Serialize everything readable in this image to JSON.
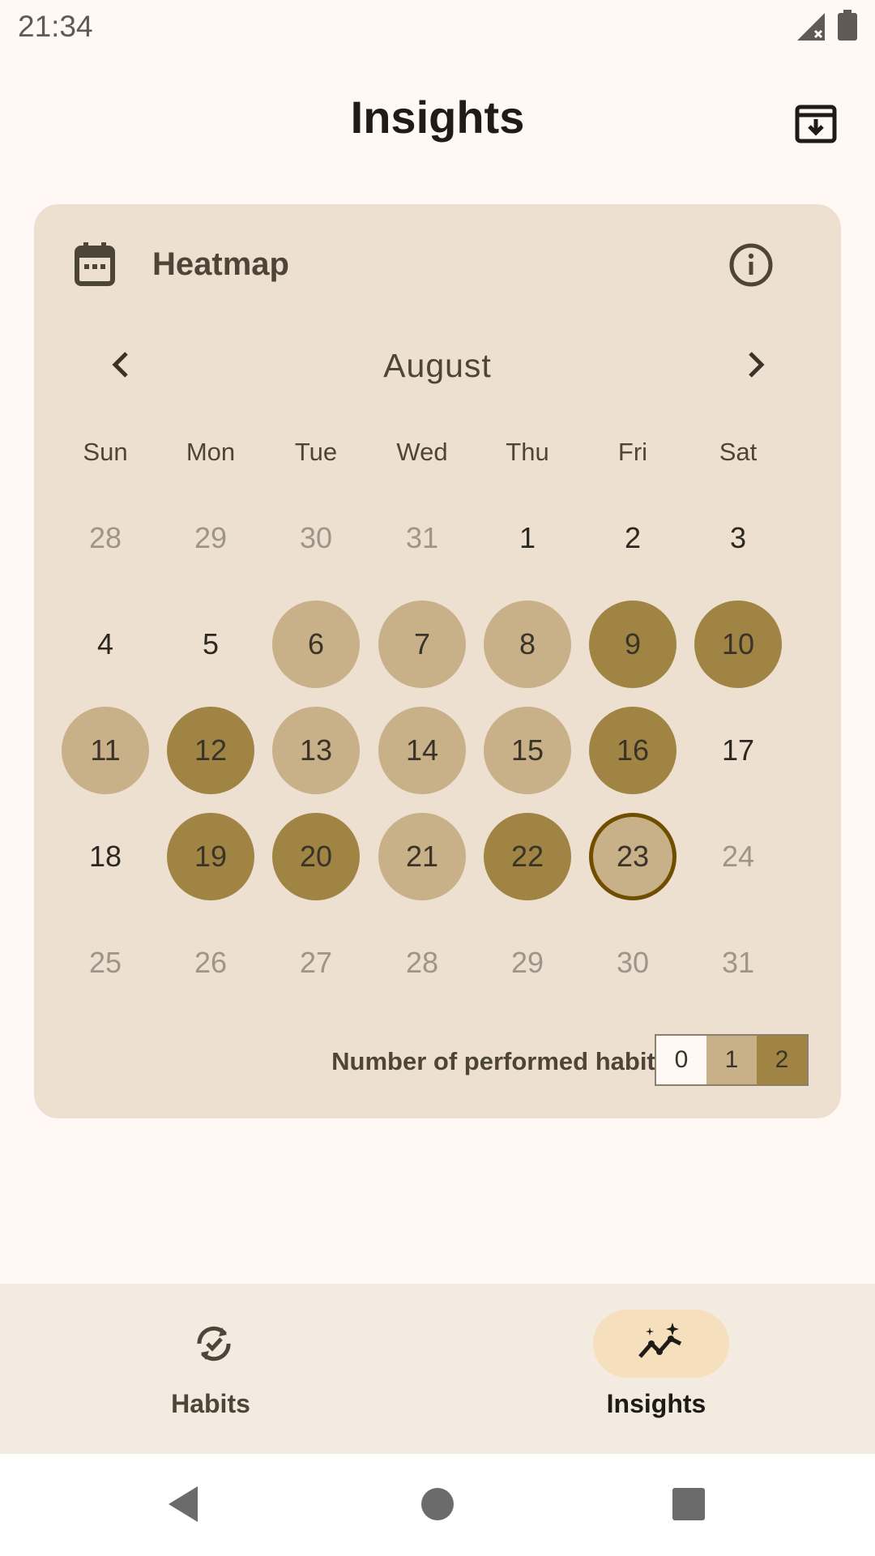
{
  "status_bar": {
    "time": "21:34",
    "icons": [
      "signal-off-icon",
      "battery-icon"
    ]
  },
  "app_bar": {
    "title": "Insights",
    "action_icon": "archive-download-icon"
  },
  "heatmap_card": {
    "title": "Heatmap",
    "header_icon": "calendar-icon",
    "info_icon": "info-icon",
    "month": "August",
    "prev_icon": "chevron-left-icon",
    "next_icon": "chevron-right-icon",
    "weekdays": [
      "Sun",
      "Mon",
      "Tue",
      "Wed",
      "Thu",
      "Fri",
      "Sat"
    ],
    "weeks": [
      [
        {
          "d": "28",
          "outside": true,
          "level": 0
        },
        {
          "d": "29",
          "outside": true,
          "level": 0
        },
        {
          "d": "30",
          "outside": true,
          "level": 0
        },
        {
          "d": "31",
          "outside": true,
          "level": 0
        },
        {
          "d": "1",
          "outside": false,
          "level": 0
        },
        {
          "d": "2",
          "outside": false,
          "level": 0
        },
        {
          "d": "3",
          "outside": false,
          "level": 0
        }
      ],
      [
        {
          "d": "4",
          "outside": false,
          "level": 0
        },
        {
          "d": "5",
          "outside": false,
          "level": 0
        },
        {
          "d": "6",
          "outside": false,
          "level": 1
        },
        {
          "d": "7",
          "outside": false,
          "level": 1
        },
        {
          "d": "8",
          "outside": false,
          "level": 1
        },
        {
          "d": "9",
          "outside": false,
          "level": 2
        },
        {
          "d": "10",
          "outside": false,
          "level": 2
        }
      ],
      [
        {
          "d": "11",
          "outside": false,
          "level": 1
        },
        {
          "d": "12",
          "outside": false,
          "level": 2
        },
        {
          "d": "13",
          "outside": false,
          "level": 1
        },
        {
          "d": "14",
          "outside": false,
          "level": 1
        },
        {
          "d": "15",
          "outside": false,
          "level": 1
        },
        {
          "d": "16",
          "outside": false,
          "level": 2
        },
        {
          "d": "17",
          "outside": false,
          "level": 0
        }
      ],
      [
        {
          "d": "18",
          "outside": false,
          "level": 0
        },
        {
          "d": "19",
          "outside": false,
          "level": 2
        },
        {
          "d": "20",
          "outside": false,
          "level": 2
        },
        {
          "d": "21",
          "outside": false,
          "level": 1
        },
        {
          "d": "22",
          "outside": false,
          "level": 2
        },
        {
          "d": "23",
          "outside": false,
          "level": 1,
          "today": true
        },
        {
          "d": "24",
          "outside": true,
          "level": 0
        }
      ],
      [
        {
          "d": "25",
          "outside": true,
          "level": 0
        },
        {
          "d": "26",
          "outside": true,
          "level": 0
        },
        {
          "d": "27",
          "outside": true,
          "level": 0
        },
        {
          "d": "28",
          "outside": true,
          "level": 0
        },
        {
          "d": "29",
          "outside": true,
          "level": 0
        },
        {
          "d": "30",
          "outside": true,
          "level": 0
        },
        {
          "d": "31",
          "outside": true,
          "level": 0
        }
      ]
    ],
    "legend_label": "Number of performed habits",
    "legend_values": [
      "0",
      "1",
      "2"
    ],
    "colors": {
      "level0": "#fff8f4",
      "level1": "#c8b088",
      "level2": "#a08444",
      "today_ring": "#6f4e00",
      "card_bg": "#ede0d0"
    }
  },
  "bottom_nav": {
    "items": [
      {
        "label": "Habits",
        "icon": "habits-check-cycle-icon",
        "selected": false
      },
      {
        "label": "Insights",
        "icon": "insights-sparkle-chart-icon",
        "selected": true
      }
    ],
    "selected_pill_color": "#f5dfbc"
  },
  "system_nav": {
    "icons": [
      "back-icon",
      "home-icon",
      "recents-icon"
    ]
  }
}
